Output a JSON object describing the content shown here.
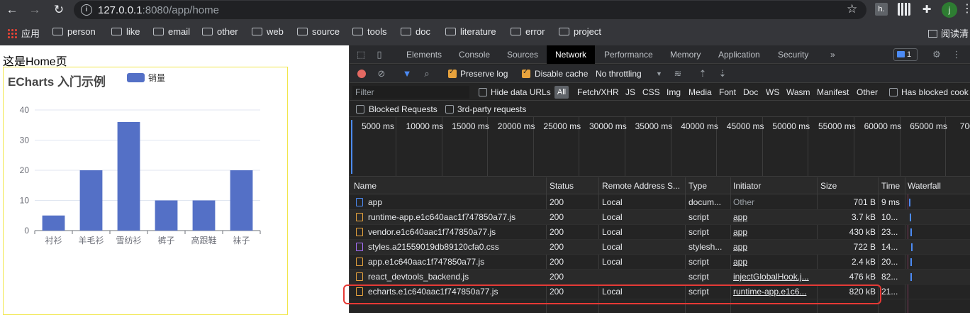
{
  "browser": {
    "url_host": "127.0.0.1",
    "url_rest": ":8080/app/home",
    "bookmarks": [
      {
        "label": "应用",
        "icon": "apps-icon"
      },
      {
        "label": "person",
        "icon": "folder-icon"
      },
      {
        "label": "like",
        "icon": "folder-icon"
      },
      {
        "label": "email",
        "icon": "folder-icon"
      },
      {
        "label": "other",
        "icon": "folder-icon"
      },
      {
        "label": "web",
        "icon": "folder-icon"
      },
      {
        "label": "source",
        "icon": "folder-icon"
      },
      {
        "label": "tools",
        "icon": "folder-icon"
      },
      {
        "label": "doc",
        "icon": "folder-icon"
      },
      {
        "label": "literature",
        "icon": "folder-icon"
      },
      {
        "label": "error",
        "icon": "folder-icon"
      },
      {
        "label": "project",
        "icon": "folder-icon"
      }
    ],
    "reading_list": "阅读清",
    "avatar_letter": "j",
    "ext_h": "h."
  },
  "page": {
    "heading": "这是Home页"
  },
  "chart_data": {
    "type": "bar",
    "title": "ECharts 入门示例",
    "legend": [
      "销量"
    ],
    "categories": [
      "衬衫",
      "羊毛衫",
      "雪纺衫",
      "裤子",
      "高跟鞋",
      "袜子"
    ],
    "series": [
      {
        "name": "销量",
        "values": [
          5,
          20,
          36,
          10,
          10,
          20
        ]
      }
    ],
    "ylim": [
      0,
      40
    ],
    "yticks": [
      0,
      10,
      20,
      30,
      40
    ],
    "color": "#5470c6",
    "grid": true,
    "legend_position": "top-center"
  },
  "devtools": {
    "tabs": [
      "Elements",
      "Console",
      "Sources",
      "Network",
      "Performance",
      "Memory",
      "Application",
      "Security",
      "»"
    ],
    "active_tab": "Network",
    "issues_count": "1",
    "toolbar": {
      "preserve_log": "Preserve log",
      "disable_cache": "Disable cache",
      "throttling": "No throttling"
    },
    "filter": {
      "placeholder": "Filter",
      "hide_data_urls": "Hide data URLs",
      "all": "All",
      "types": [
        "Fetch/XHR",
        "JS",
        "CSS",
        "Img",
        "Media",
        "Font",
        "Doc",
        "WS",
        "Wasm",
        "Manifest",
        "Other"
      ],
      "has_blocked": "Has blocked cook",
      "blocked_requests": "Blocked Requests",
      "third_party": "3rd-party requests"
    },
    "timeline_ticks": [
      "5000 ms",
      "10000 ms",
      "15000 ms",
      "20000 ms",
      "25000 ms",
      "30000 ms",
      "35000 ms",
      "40000 ms",
      "45000 ms",
      "50000 ms",
      "55000 ms",
      "60000 ms",
      "65000 ms",
      "70000"
    ],
    "columns": [
      "Name",
      "Status",
      "Remote Address S...",
      "Type",
      "Initiator",
      "Size",
      "Time",
      "Waterfall"
    ],
    "rows": [
      {
        "name": "app",
        "status": "200",
        "remote": "Local",
        "type": "docum...",
        "initiator": "Other",
        "size": "701 B",
        "time": "9 ms",
        "kind": "doc"
      },
      {
        "name": "runtime-app.e1c640aac1f747850a77.js",
        "status": "200",
        "remote": "Local",
        "type": "script",
        "initiator": "app",
        "size": "3.7 kB",
        "time": "10...",
        "kind": "js"
      },
      {
        "name": "vendor.e1c640aac1f747850a77.js",
        "status": "200",
        "remote": "Local",
        "type": "script",
        "initiator": "app",
        "size": "430 kB",
        "time": "23...",
        "kind": "js"
      },
      {
        "name": "styles.a21559019db89120cfa0.css",
        "status": "200",
        "remote": "Local",
        "type": "stylesh...",
        "initiator": "app",
        "size": "722 B",
        "time": "14...",
        "kind": "css"
      },
      {
        "name": "app.e1c640aac1f747850a77.js",
        "status": "200",
        "remote": "Local",
        "type": "script",
        "initiator": "app",
        "size": "2.4 kB",
        "time": "20...",
        "kind": "js"
      },
      {
        "name": "react_devtools_backend.js",
        "status": "200",
        "remote": "",
        "type": "script",
        "initiator": "injectGlobalHook.j...",
        "size": "476 kB",
        "time": "82...",
        "kind": "js"
      },
      {
        "name": "echarts.e1c640aac1f747850a77.js",
        "status": "200",
        "remote": "Local",
        "type": "script",
        "initiator": "runtime-app.e1c6...",
        "size": "820 kB",
        "time": "21...",
        "kind": "js"
      }
    ]
  }
}
